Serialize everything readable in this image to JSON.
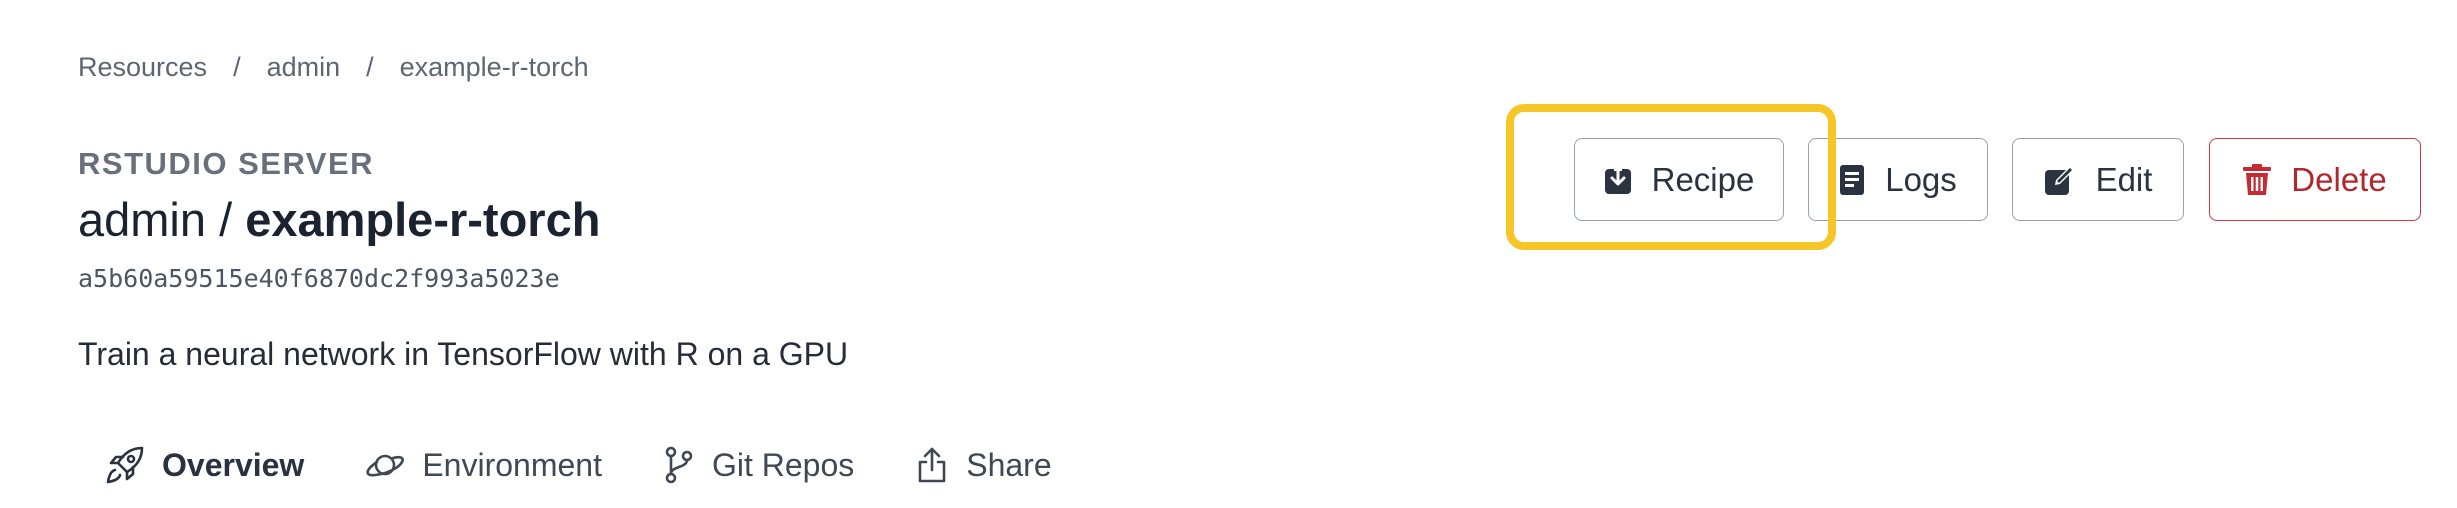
{
  "breadcrumb": {
    "items": [
      "Resources",
      "admin",
      "example-r-torch"
    ],
    "separator": "/"
  },
  "resource": {
    "type": "RSTUDIO SERVER",
    "owner": "admin",
    "title_separator": "/",
    "name": "example-r-torch",
    "hash": "a5b60a59515e40f6870dc2f993a5023e",
    "description": "Train a neural network in TensorFlow with R on a GPU"
  },
  "actions": {
    "recipe": {
      "label": "Recipe",
      "icon": "download-icon"
    },
    "logs": {
      "label": "Logs",
      "icon": "document-icon"
    },
    "edit": {
      "label": "Edit",
      "icon": "edit-icon"
    },
    "delete": {
      "label": "Delete",
      "icon": "trash-icon"
    }
  },
  "tabs": [
    {
      "label": "Overview",
      "icon": "rocket-icon",
      "active": true
    },
    {
      "label": "Environment",
      "icon": "planet-icon",
      "active": false
    },
    {
      "label": "Git Repos",
      "icon": "git-branch-icon",
      "active": false
    },
    {
      "label": "Share",
      "icon": "share-icon",
      "active": false
    }
  ],
  "colors": {
    "highlight": "#f6c628",
    "delete": "#c52b30",
    "text": "#1f2733",
    "muted": "#5d6672"
  }
}
